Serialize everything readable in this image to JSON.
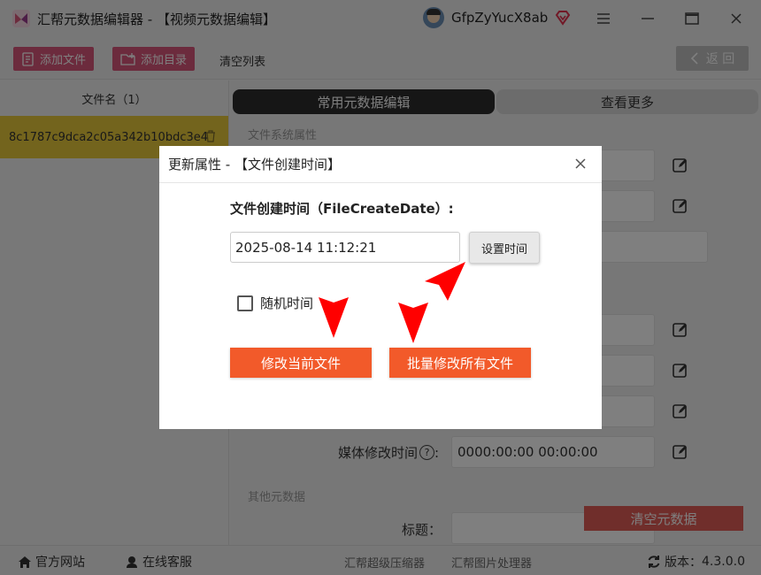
{
  "window": {
    "title": "汇帮元数据编辑器 - 【视频元数据编辑】",
    "username": "GfpZyYucX8ab"
  },
  "toolbar": {
    "add_file": "添加文件",
    "add_folder": "添加目录",
    "clear_list": "清空列表",
    "back": "返 回"
  },
  "file_list": {
    "header": "文件名（1）",
    "items": [
      "8c1787c9dca2c05a342b10bdc3e4"
    ]
  },
  "tabs": {
    "common": "常用元数据编辑",
    "more": "查看更多"
  },
  "sections": {
    "filesystem": "文件系统属性",
    "other": "其他元数据"
  },
  "fields": {
    "media_modify_label": "媒体修改时间",
    "media_modify_value": "0000:00:00 00:00:00",
    "title_label": "标题："
  },
  "clear_meta": "清空元数据",
  "bottom": {
    "website": "官方网站",
    "support": "在线客服",
    "compressor": "汇帮超级压缩器",
    "image_tool": "汇帮图片处理器",
    "version_label": "版本：",
    "version_value": "4.3.0.0"
  },
  "dialog": {
    "title": "更新属性 - 【文件创建时间】",
    "label": "文件创建时间（FileCreateDate）:",
    "date_value": "2025-08-14 11:12:21",
    "set_time": "设置时间",
    "random_time": "随机时间",
    "modify_current": "修改当前文件",
    "batch_modify": "批量修改所有文件"
  },
  "colors": {
    "accent_pink": "#d9567a",
    "selected_row": "#e6c83a",
    "orange": "#f25a2a",
    "clear_red": "#e15d57",
    "arrow_red": "#ff0000"
  }
}
